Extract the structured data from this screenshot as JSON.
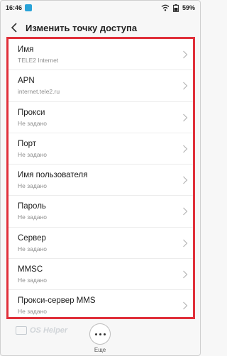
{
  "status_bar": {
    "time": "16:46",
    "battery": "59%",
    "icons": [
      "notification-icon",
      "wifi-icon",
      "battery-icon"
    ]
  },
  "header": {
    "back_icon": "chevron-left-icon",
    "title": "Изменить точку доступа"
  },
  "settings": [
    {
      "label": "Имя",
      "value": "TELE2 Internet"
    },
    {
      "label": "APN",
      "value": "internet.tele2.ru"
    },
    {
      "label": "Прокси",
      "value": "Не задано"
    },
    {
      "label": "Порт",
      "value": "Не задано"
    },
    {
      "label": "Имя пользователя",
      "value": "Не задано"
    },
    {
      "label": "Пароль",
      "value": "Не задано"
    },
    {
      "label": "Сервер",
      "value": "Не задано"
    },
    {
      "label": "MMSC",
      "value": "Не задано"
    },
    {
      "label": "Прокси-сервер MMS",
      "value": "Не задано"
    }
  ],
  "bottom": {
    "watermark": "OS Helper",
    "more_label": "Еще"
  },
  "colors": {
    "highlight_border": "#e0303a",
    "notification_icon": "#2aa3d8"
  }
}
